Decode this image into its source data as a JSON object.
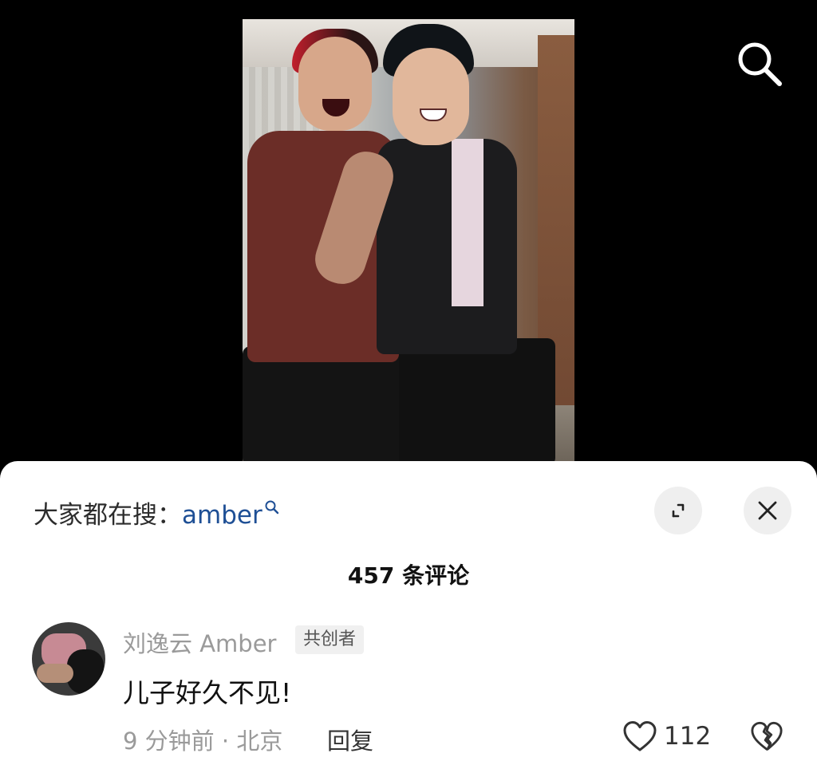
{
  "header": {
    "search_icon": "search-icon"
  },
  "trending": {
    "prefix": "大家都在搜：",
    "keyword": "amber"
  },
  "comments_header": {
    "count_text": "457 条评论"
  },
  "comment": {
    "username": "刘逸云 Amber",
    "badge": "共创者",
    "text": "儿子好久不见!",
    "time_location": "9 分钟前 · 北京",
    "reply_label": "回复",
    "likes": "112"
  },
  "icons": [
    "search-icon",
    "expand-icon",
    "close-icon",
    "heart-icon",
    "broken-heart-icon"
  ],
  "colors": {
    "keyword": "#1e4f95",
    "sheet_bg": "#ffffff",
    "page_bg": "#000000"
  }
}
